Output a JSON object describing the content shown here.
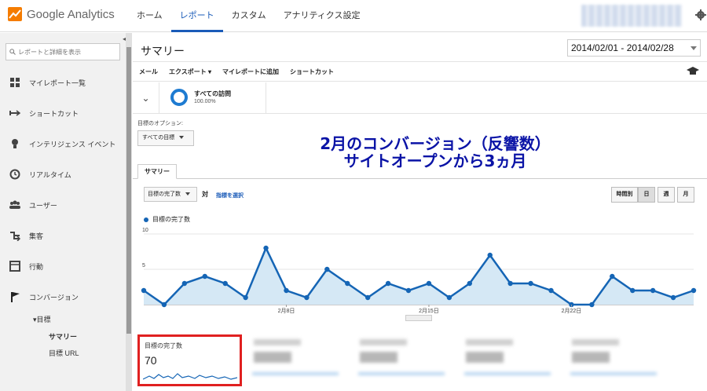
{
  "header": {
    "logo_text": "Google Analytics",
    "nav": [
      "ホーム",
      "レポート",
      "カスタム",
      "アナリティクス設定"
    ],
    "active_nav": 1,
    "brand_orange": "#f57c00",
    "accent": "#1a5bb8"
  },
  "sidebar": {
    "search_placeholder": "レポートと詳細を表示",
    "items": [
      {
        "label": "マイレポート一覧",
        "icon": "grid-icon"
      },
      {
        "label": "ショートカット",
        "icon": "shortcut-arrow-icon"
      },
      {
        "label": "インテリジェンス イベント",
        "icon": "lightbulb-icon"
      },
      {
        "label": "リアルタイム",
        "icon": "clock-icon"
      },
      {
        "label": "ユーザー",
        "icon": "users-icon"
      },
      {
        "label": "集客",
        "icon": "acquisition-icon"
      },
      {
        "label": "行動",
        "icon": "behavior-icon"
      },
      {
        "label": "コンバージョン",
        "icon": "flag-icon"
      }
    ],
    "sub": {
      "group": "▾目標",
      "summary": "サマリー",
      "goal_url": "目標 URL"
    }
  },
  "main": {
    "title": "サマリー",
    "date_range": "2014/02/01 - 2014/02/28",
    "toolbar": [
      "メール",
      "エクスポート ▾",
      "マイレポートに追加",
      "ショートカット"
    ],
    "segment": {
      "name": "すべての訪問",
      "percent": "100.00%"
    },
    "goal_option_label": "目標のオプション:",
    "goal_select": "すべての目標",
    "tab": "サマリー",
    "metric_select": "目標の完了数",
    "vs": "対",
    "pick_metric": "指標を選択",
    "granularity": [
      "時間別",
      "日",
      "週",
      "月"
    ],
    "granularity_selected": 1,
    "legend": "目標の完了数",
    "overlay_line1": "2月のコンバージョン（反響数）",
    "overlay_line2": "サイトオープンから3ヵ月",
    "scorecard": {
      "title": "目標の完了数",
      "value": "70"
    }
  },
  "chart_data": {
    "type": "area",
    "series": [
      {
        "name": "目標の完了数",
        "values": [
          2,
          0,
          3,
          4,
          3,
          1,
          8,
          2,
          1,
          5,
          3,
          1,
          3,
          2,
          3,
          1,
          3,
          7,
          3,
          3,
          2,
          0,
          0,
          4,
          2,
          2,
          1,
          2
        ]
      }
    ],
    "x": [
      1,
      2,
      3,
      4,
      5,
      6,
      7,
      8,
      9,
      10,
      11,
      12,
      13,
      14,
      15,
      16,
      17,
      18,
      19,
      20,
      21,
      22,
      23,
      24,
      25,
      26,
      27,
      28
    ],
    "xtick_labels": [
      {
        "x": 8,
        "label": "2月8日"
      },
      {
        "x": 15,
        "label": "2月15日"
      },
      {
        "x": 22,
        "label": "2月22日"
      }
    ],
    "yticks": [
      5,
      10
    ],
    "ylim": [
      0,
      10
    ],
    "line_color": "#1565b5",
    "fill_color": "#d5e8f5",
    "grid": true
  }
}
